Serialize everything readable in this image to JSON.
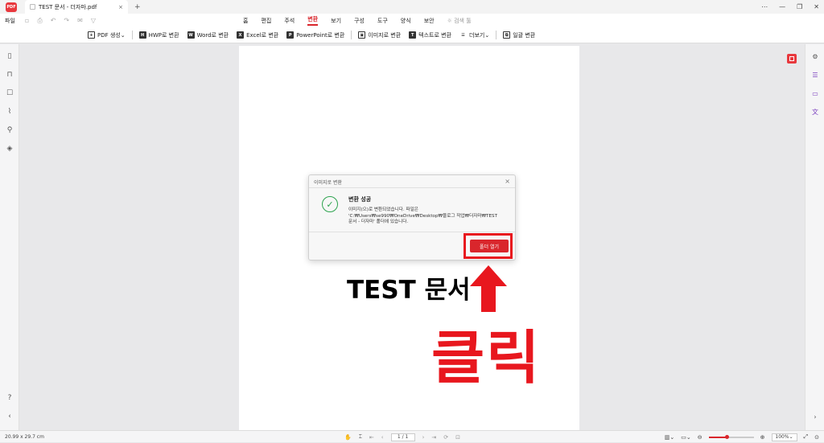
{
  "titlebar": {
    "tab_title": "TEST 문서 - 더자마.pdf",
    "tab_close": "×",
    "new_tab": "+",
    "logo_text": "PDF",
    "minimize": "—",
    "restore": "❐",
    "close": "✕"
  },
  "menubar": {
    "file": "파일",
    "tabs": [
      "홈",
      "편집",
      "주석",
      "변환",
      "보기",
      "구성",
      "도구",
      "양식",
      "보안"
    ],
    "active_tab": "변환",
    "search": "검색 툴"
  },
  "ribbon": {
    "items": [
      {
        "label": "PDF 생성⌄",
        "icon": "+"
      },
      {
        "label": "HWP로 변환",
        "icon": "H"
      },
      {
        "label": "Word로 변환",
        "icon": "W"
      },
      {
        "label": "Excel로 변환",
        "icon": "X"
      },
      {
        "label": "PowerPoint로 변환",
        "icon": "P"
      },
      {
        "label": "이미지로 변환",
        "icon": "▣"
      },
      {
        "label": "텍스트로 변환",
        "icon": "T"
      },
      {
        "label": "더보기⌄",
        "icon": "☰"
      },
      {
        "label": "일괄 변환",
        "icon": "⧉"
      }
    ]
  },
  "dialog": {
    "title": "이미지로 변환",
    "close": "×",
    "heading": "변환 성공",
    "message_1": "이미지(으)로 변환되었습니다. 파일은",
    "message_2": "'C:₩Users₩se990₩OneDrive₩Desktop₩블로그 작업₩더자마₩TEST",
    "message_3": "문서 - 더자마' 폴더에 있습니다.",
    "button": "폴더 열기"
  },
  "document": {
    "text": "TEST 문서"
  },
  "annotation": {
    "text": "클릭"
  },
  "statusbar": {
    "page_size": "20.99 x 29.7 cm",
    "page_indicator": "1 / 1",
    "zoom": "100%",
    "zoom_level": 0.4
  },
  "colors": {
    "accent": "#d9262c",
    "success": "#2ea44f",
    "annotation": "#e8171e"
  }
}
